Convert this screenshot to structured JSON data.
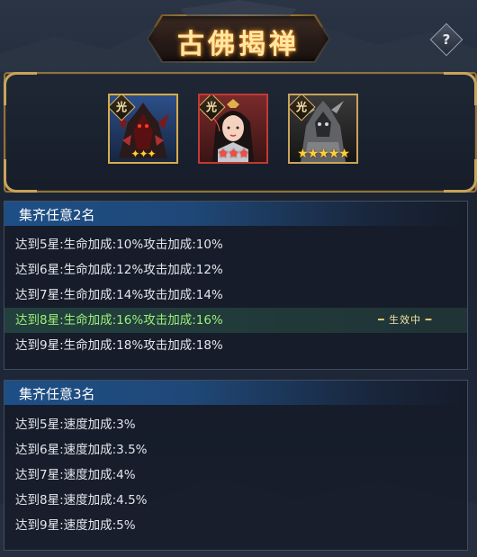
{
  "title": "古佛揭禅",
  "help_label": "?",
  "heroes": [
    {
      "badge": "光",
      "stars": "✦✦✦",
      "star_style": "gold-wing"
    },
    {
      "badge": "光",
      "stars": "★★★",
      "star_style": "red"
    },
    {
      "badge": "光",
      "stars": "★★★★★",
      "star_style": "gold"
    }
  ],
  "sections": [
    {
      "header": "集齐任意2名",
      "rows": [
        {
          "text": "达到5星:生命加成:10%攻击加成:10%",
          "active": false
        },
        {
          "text": "达到6星:生命加成:12%攻击加成:12%",
          "active": false
        },
        {
          "text": "达到7星:生命加成:14%攻击加成:14%",
          "active": false
        },
        {
          "text": "达到8星:生命加成:16%攻击加成:16%",
          "active": true
        },
        {
          "text": "达到9星:生命加成:18%攻击加成:18%",
          "active": false
        }
      ]
    },
    {
      "header": "集齐任意3名",
      "rows": [
        {
          "text": "达到5星:速度加成:3%",
          "active": false
        },
        {
          "text": "达到6星:速度加成:3.5%",
          "active": false
        },
        {
          "text": "达到7星:速度加成:4%",
          "active": false
        },
        {
          "text": "达到8星:速度加成:4.5%",
          "active": false
        },
        {
          "text": "达到9星:速度加成:5%",
          "active": false
        }
      ]
    }
  ],
  "active_tag": "生效中",
  "colors": {
    "header_blue": "#1d4f86",
    "active_text": "#9bf07a",
    "gold_border": "#d7ac4b",
    "red_border": "#c03a34"
  }
}
